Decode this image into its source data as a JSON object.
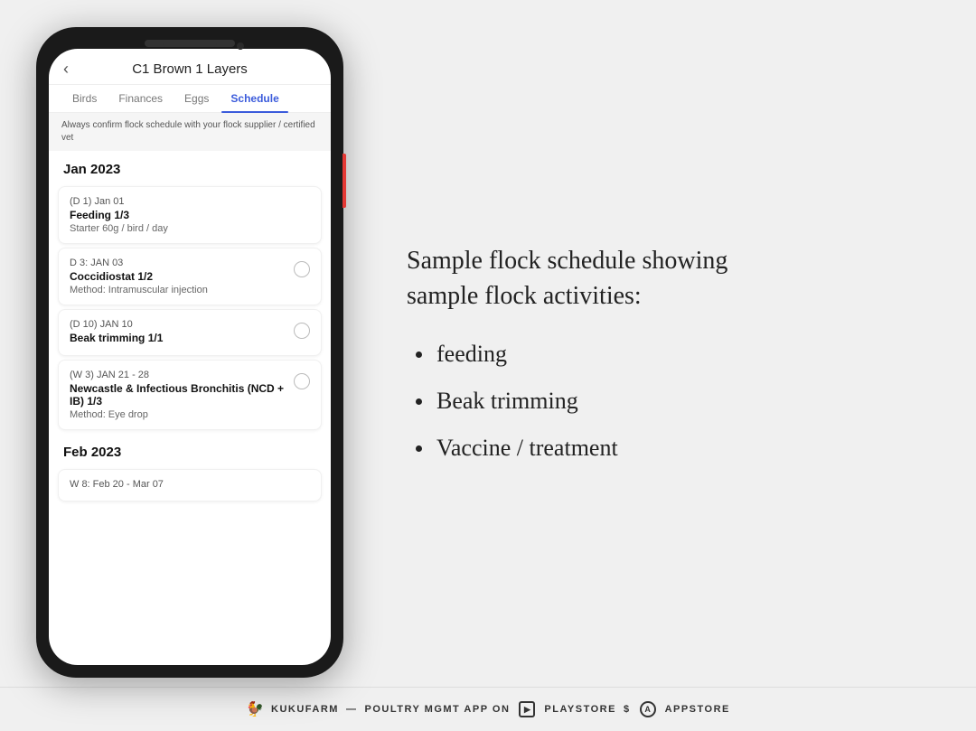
{
  "app": {
    "title": "C1 Brown 1 Layers",
    "back_label": "‹",
    "tabs": [
      {
        "label": "Birds",
        "active": false
      },
      {
        "label": "Finances",
        "active": false
      },
      {
        "label": "Eggs",
        "active": false
      },
      {
        "label": "Schedule",
        "active": true
      }
    ],
    "notice": "Always confirm flock schedule with your flock supplier / certified vet",
    "sections": [
      {
        "month": "Jan 2023",
        "items": [
          {
            "date": "(D 1) Jan 01",
            "title": "Feeding 1/3",
            "detail": "Starter 60g / bird / day",
            "has_checkbox": false
          },
          {
            "date": "D 3: JAN 03",
            "title": "Coccidiostat 1/2",
            "detail": "Method: Intramuscular injection",
            "has_checkbox": true
          },
          {
            "date": "(D 10) JAN 10",
            "title": "Beak trimming 1/1",
            "detail": "",
            "has_checkbox": true
          },
          {
            "date": "(W 3) JAN 21 - 28",
            "title": "Newcastle & Infectious Bronchitis (NCD + IB) 1/3",
            "detail": "Method: Eye drop",
            "has_checkbox": true
          }
        ]
      },
      {
        "month": "Feb 2023",
        "items": [
          {
            "date": "W 8: Feb 20 - Mar 07",
            "title": "",
            "detail": "",
            "has_checkbox": false
          }
        ]
      }
    ]
  },
  "text_panel": {
    "title_line1": "Sample flock schedule showing",
    "title_line2": "sample flock activities:",
    "bullets": [
      "feeding",
      "Beak trimming",
      "Vaccine / treatment"
    ]
  },
  "footer": {
    "chicken_icon": "🐓",
    "brand": "KUKUFARM",
    "separator": "—",
    "tagline": "POULTRY MGMT APP ON",
    "playstore_label": "PLAYSTORE",
    "appstore_label": "APPSTORE"
  }
}
